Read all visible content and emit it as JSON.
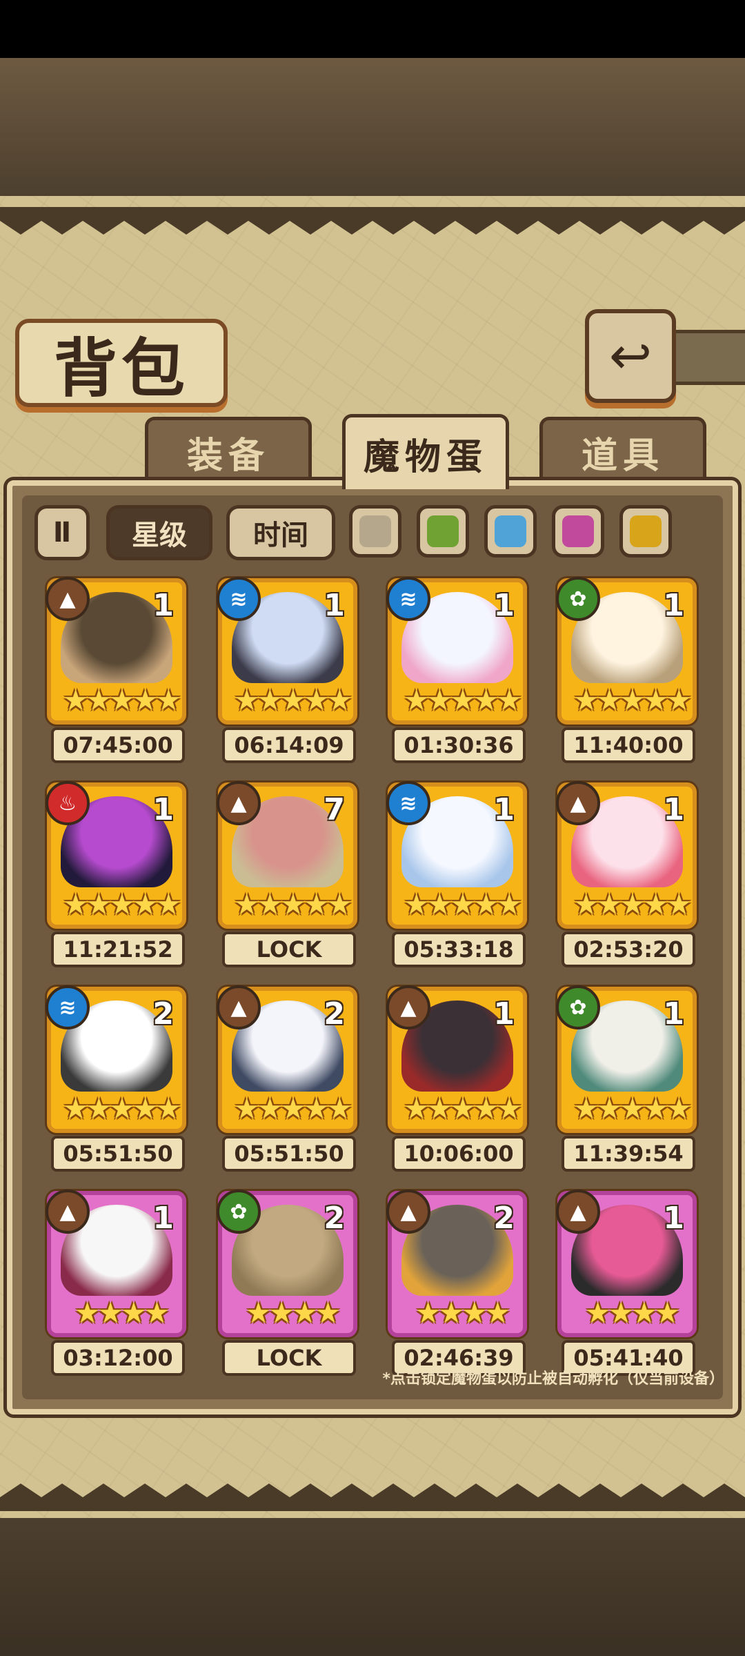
{
  "page": {
    "title": "背包",
    "tabs": [
      "装备",
      "魔物蛋",
      "道具"
    ],
    "active_tab": 1,
    "filters": {
      "sort_icon_label": "Ⅱ",
      "star_label": "星级",
      "time_label": "时间",
      "color_swatches": [
        "#b4a78c",
        "#6fa232",
        "#4fa3d6",
        "#c14a9c",
        "#d8a51a"
      ]
    },
    "footer_note": "*点击锁定魔物蛋以防止被自动孵化（仅当前设备）"
  },
  "eggs": [
    {
      "element": "earth",
      "count": "1",
      "stars": "★★★★★",
      "timer": "07:45:00",
      "frame": "gold",
      "colors": [
        "#5a4a35",
        "#c9a57a"
      ]
    },
    {
      "element": "water",
      "count": "1",
      "stars": "★★★★★",
      "timer": "06:14:09",
      "frame": "gold",
      "colors": [
        "#cfdcf4",
        "#3b3b4a"
      ]
    },
    {
      "element": "water",
      "count": "1",
      "stars": "★★★★★",
      "timer": "01:30:36",
      "frame": "gold",
      "colors": [
        "#f3f6ff",
        "#f0a6c9"
      ]
    },
    {
      "element": "nature",
      "count": "1",
      "stars": "★★★★★",
      "timer": "11:40:00",
      "frame": "gold",
      "colors": [
        "#fff4e0",
        "#b8a07a"
      ]
    },
    {
      "element": "fire",
      "count": "1",
      "stars": "★★★★★",
      "timer": "11:21:52",
      "frame": "gold",
      "colors": [
        "#b64bcf",
        "#221a3a"
      ]
    },
    {
      "element": "earth",
      "count": "7",
      "stars": "★★★★★",
      "timer": "LOCK",
      "frame": "gold",
      "colors": [
        "#d8948c",
        "#cbbd93"
      ]
    },
    {
      "element": "water",
      "count": "1",
      "stars": "★★★★★",
      "timer": "05:33:18",
      "frame": "gold",
      "colors": [
        "#f5f8ff",
        "#a8c6ea"
      ]
    },
    {
      "element": "earth",
      "count": "1",
      "stars": "★★★★★",
      "timer": "02:53:20",
      "frame": "gold",
      "colors": [
        "#fde1ea",
        "#e9647f"
      ]
    },
    {
      "element": "water",
      "count": "2",
      "stars": "★★★★★",
      "timer": "05:51:50",
      "frame": "gold",
      "colors": [
        "#ffffff",
        "#3a3a3a"
      ]
    },
    {
      "element": "earth",
      "count": "2",
      "stars": "★★★★★",
      "timer": "05:51:50",
      "frame": "gold",
      "colors": [
        "#f4f5fb",
        "#3f4a63"
      ]
    },
    {
      "element": "earth",
      "count": "1",
      "stars": "★★★★★",
      "timer": "10:06:00",
      "frame": "gold",
      "colors": [
        "#3b3036",
        "#9a2a2a"
      ]
    },
    {
      "element": "nature",
      "count": "1",
      "stars": "★★★★★",
      "timer": "11:39:54",
      "frame": "gold",
      "colors": [
        "#f0efe8",
        "#4f8a7a"
      ]
    },
    {
      "element": "earth",
      "count": "1",
      "stars": "★★★★",
      "timer": "03:12:00",
      "frame": "purple",
      "colors": [
        "#f7f7f7",
        "#8a2a4a"
      ]
    },
    {
      "element": "nature",
      "count": "2",
      "stars": "★★★★",
      "timer": "LOCK",
      "frame": "purple",
      "colors": [
        "#c2a981",
        "#8f7a55"
      ]
    },
    {
      "element": "earth",
      "count": "2",
      "stars": "★★★★",
      "timer": "02:46:39",
      "frame": "purple",
      "colors": [
        "#6a6259",
        "#e2a43a"
      ]
    },
    {
      "element": "earth",
      "count": "1",
      "stars": "★★★★",
      "timer": "05:41:40",
      "frame": "purple",
      "colors": [
        "#e65a95",
        "#2b2b2b"
      ]
    }
  ],
  "element_colors": {
    "earth": "#7a4a2a",
    "water": "#1f7fd1",
    "nature": "#3f8a2a",
    "fire": "#d12b2b"
  },
  "element_glyphs": {
    "earth": "▲",
    "water": "≋",
    "nature": "✿",
    "fire": "♨"
  }
}
